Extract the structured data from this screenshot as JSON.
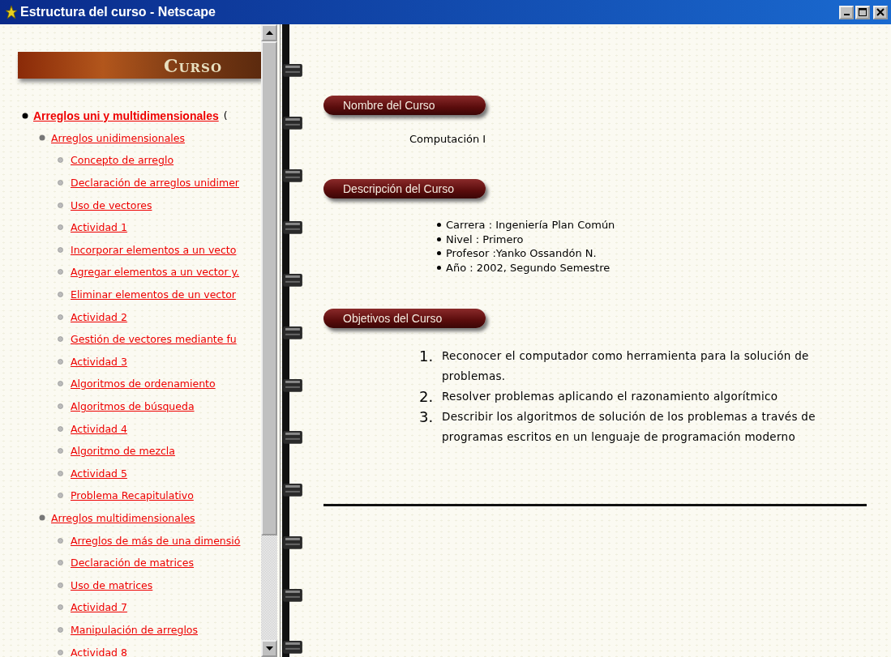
{
  "window": {
    "title": "Estructura del curso - Netscape"
  },
  "sidebar": {
    "banner": "Curso",
    "tree": [
      {
        "label": "Arreglos uni y multidimensionales",
        "suffix": "(",
        "children": [
          {
            "label": "Arreglos unidimensionales",
            "children": [
              {
                "label": "Concepto de arreglo"
              },
              {
                "label": "Declaración de arreglos unidimer"
              },
              {
                "label": "Uso de vectores"
              },
              {
                "label": "Actividad 1"
              },
              {
                "label": "Incorporar elementos a un vecto"
              },
              {
                "label": "Agregar elementos a un vector y."
              },
              {
                "label": "Eliminar elementos de un vector"
              },
              {
                "label": "Actividad 2"
              },
              {
                "label": "Gestión de vectores mediante fu"
              },
              {
                "label": "Actividad 3"
              },
              {
                "label": "Algoritmos de ordenamiento"
              },
              {
                "label": "Algoritmos de búsqueda"
              },
              {
                "label": "Actividad 4"
              },
              {
                "label": "Algoritmo de mezcla"
              },
              {
                "label": "Actividad 5"
              },
              {
                "label": "Problema Recapitulativo"
              }
            ]
          },
          {
            "label": "Arreglos multidimensionales",
            "children": [
              {
                "label": "Arreglos de más de una dimensió"
              },
              {
                "label": "Declaración de matrices"
              },
              {
                "label": "Uso de matrices"
              },
              {
                "label": "Actividad 7"
              },
              {
                "label": "Manipulación de arreglos"
              },
              {
                "label": "Actividad 8"
              }
            ]
          }
        ]
      }
    ]
  },
  "content": {
    "sections": [
      {
        "heading": "Nombre del Curso",
        "kind": "text",
        "text": "Computación I"
      },
      {
        "heading": "Descripción del Curso",
        "kind": "bullets",
        "items": [
          "Carrera : Ingeniería Plan Común",
          "Nivel : Primero",
          "Profesor :Yanko Ossandón N.",
          "Año : 2002, Segundo Semestre"
        ]
      },
      {
        "heading": "Objetivos del Curso",
        "kind": "numbered",
        "items": [
          {
            "number": "1.",
            "text": "Reconocer el computador como herramienta para la solución de problemas."
          },
          {
            "number": "2.",
            "text": "Resolver problemas aplicando el razonamiento algorítmico"
          },
          {
            "number": "3.",
            "text": "Describir los algoritmos de solución de los problemas a través de programas escritos en un lenguaje de programación moderno"
          }
        ]
      }
    ]
  }
}
